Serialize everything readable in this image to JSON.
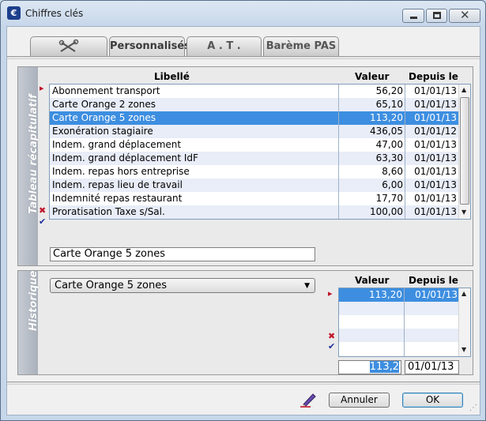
{
  "window": {
    "title": "Chiffres clés",
    "icon_letter": "€"
  },
  "tabs": [
    {
      "label": "",
      "icon": "wrench-tools-icon"
    },
    {
      "label": "Personnalisés"
    },
    {
      "label": "A . T ."
    },
    {
      "label": "Barème PAS"
    }
  ],
  "summary": {
    "side_label": "Tableau récapitulatif",
    "columns": {
      "libelle": "Libellé",
      "valeur": "Valeur",
      "depuis": "Depuis le"
    },
    "rows": [
      {
        "libelle": "Abonnement transport",
        "valeur": "56,20",
        "depuis": "01/01/13"
      },
      {
        "libelle": "Carte Orange 2 zones",
        "valeur": "65,10",
        "depuis": "01/01/13"
      },
      {
        "libelle": "Carte Orange 5 zones",
        "valeur": "113,20",
        "depuis": "01/01/13"
      },
      {
        "libelle": "Exonération stagiaire",
        "valeur": "436,05",
        "depuis": "01/01/12"
      },
      {
        "libelle": "Indem. grand déplacement",
        "valeur": "47,00",
        "depuis": "01/01/13"
      },
      {
        "libelle": "Indem. grand déplacement IdF",
        "valeur": "63,30",
        "depuis": "01/01/13"
      },
      {
        "libelle": "Indem. repas hors entreprise",
        "valeur": "8,60",
        "depuis": "01/01/13"
      },
      {
        "libelle": "Indem. repas lieu de travail",
        "valeur": "6,00",
        "depuis": "01/01/13"
      },
      {
        "libelle": "Indemnité repas restaurant",
        "valeur": "17,70",
        "depuis": "01/01/13"
      },
      {
        "libelle": "Proratisation Taxe s/Sal.",
        "valeur": "100,00",
        "depuis": "01/01/13"
      }
    ],
    "selected_index": 2,
    "edit_value": "Carte Orange 5 zones"
  },
  "history": {
    "side_label": "Historique",
    "combo_value": "Carte Orange 5 zones",
    "columns": {
      "valeur": "Valeur",
      "depuis": "Depuis le"
    },
    "rows": [
      {
        "valeur": "113,20",
        "depuis": "01/01/13"
      }
    ],
    "edit_valeur": "113,2",
    "edit_depuis": "01/01/13"
  },
  "footer": {
    "cancel_label": "Annuler",
    "ok_label": "OK"
  },
  "colors": {
    "selection": "#3d8ee0",
    "alt_row": "#e8edf8",
    "marker_red": "#c0162b",
    "marker_blue": "#1a2f9c"
  }
}
